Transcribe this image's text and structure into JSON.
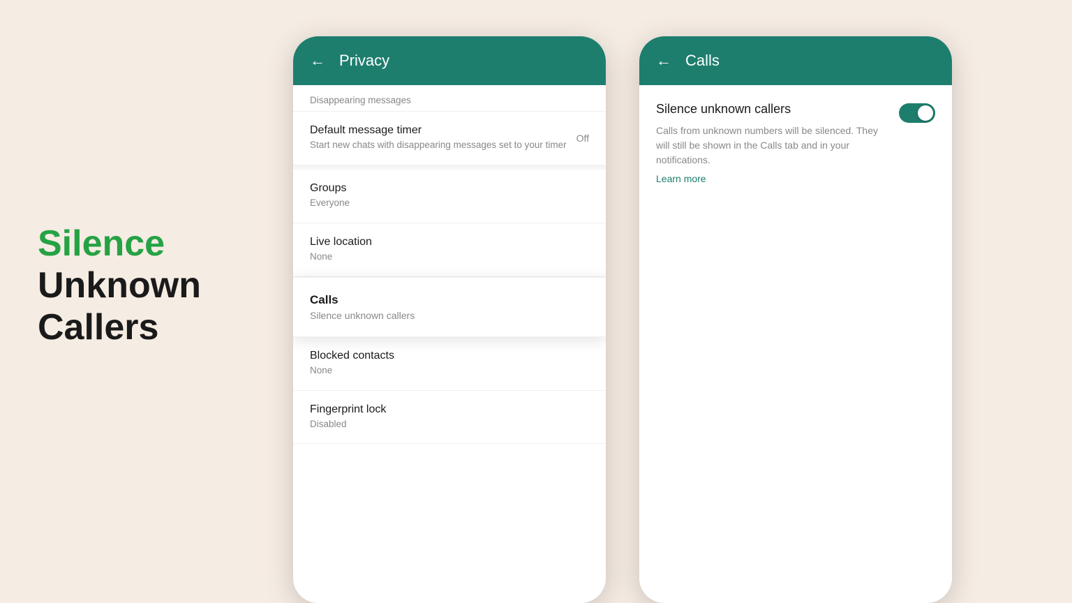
{
  "background_color": "#f5ece3",
  "hero": {
    "line1": "Silence",
    "line2": "Unknown",
    "line3": "Callers"
  },
  "left_phone": {
    "header": {
      "back_label": "←",
      "title": "Privacy"
    },
    "section_label": "Disappearing messages",
    "settings": [
      {
        "title": "Default message timer",
        "subtitle": "Start new chats with disappearing messages set to your timer",
        "value": "Off"
      },
      {
        "title": "Groups",
        "subtitle": "Everyone",
        "value": ""
      },
      {
        "title": "Live location",
        "subtitle": "None",
        "value": ""
      }
    ],
    "calls_section": {
      "title": "Calls",
      "subtitle": "Silence unknown callers"
    },
    "bottom_settings": [
      {
        "title": "Blocked contacts",
        "subtitle": "None"
      },
      {
        "title": "Fingerprint lock",
        "subtitle": "Disabled"
      }
    ]
  },
  "right_phone": {
    "header": {
      "back_label": "←",
      "title": "Calls"
    },
    "silence_setting": {
      "title": "Silence unknown callers",
      "description": "Calls from unknown numbers will be silenced. They will still be shown in the Calls tab and in your notifications.",
      "learn_more": "Learn more",
      "toggle_enabled": true
    }
  }
}
